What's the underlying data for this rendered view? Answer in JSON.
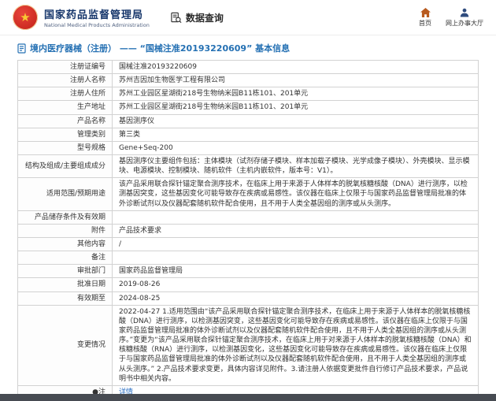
{
  "header": {
    "org_name": "国家药品监督管理局",
    "org_name_en": "National Medical Products Administration",
    "data_query": "数据查询",
    "home": "首页",
    "service_hall": "网上办事大厅"
  },
  "page": {
    "title": "境内医疗器械（注册） —— “国械注准20193220609” 基本信息"
  },
  "icons": {
    "logo-star": "★",
    "data-query": "clipboard-magnifier",
    "home": "house",
    "service-hall": "person",
    "page-title": "document"
  },
  "colors": {
    "accent_blue": "#2470b3",
    "org_navy": "#16366b",
    "logo_red": "#d6281e",
    "logo_gold": "#f8c933",
    "link_blue": "#2a6fc4",
    "border": "#d2d2d2",
    "footer": "#474b52"
  },
  "detail": {
    "rows": [
      {
        "label": "注册证编号",
        "value": "国械注准20193220609"
      },
      {
        "label": "注册人名称",
        "value": "苏州吉因加生物医学工程有限公司"
      },
      {
        "label": "注册人住所",
        "value": "苏州工业园区星湖街218号生物纳米园B11栋101、201单元"
      },
      {
        "label": "生产地址",
        "value": "苏州工业园区星湖街218号生物纳米园B11栋101、201单元"
      },
      {
        "label": "产品名称",
        "value": "基因测序仪"
      },
      {
        "label": "管理类别",
        "value": "第三类"
      },
      {
        "label": "型号规格",
        "value": "Gene+Seq-200"
      },
      {
        "label": "结构及组成/主要组成成分",
        "value": "基因测序仪主要组件包括：主体模块（试剂存储子模块、样本加载子模块、光学成像子模块）、外壳模块、显示模块、电源模块、控制模块、随机软件（主机内嵌软件，版本号：V1）。"
      },
      {
        "label": "适用范围/预期用途",
        "value": "该产品采用联合探针锚定聚合测序技术，在临床上用于来源于人体样本的脱氧核糖核酸（DNA）进行测序，以检测基因突变，这些基因变化可能导致存在疾病或易感性。该仪器在临床上仅限于与国家药品监督管理局批准的体外诊断试剂以及仪器配套随机软件配合使用，且不用于人类全基因组的测序或从头测序。"
      },
      {
        "label": "产品储存条件及有效期",
        "value": ""
      },
      {
        "label": "附件",
        "value": "产品技术要求"
      },
      {
        "label": "其他内容",
        "value": "/"
      },
      {
        "label": "备注",
        "value": ""
      },
      {
        "label": "审批部门",
        "value": "国家药品监督管理局"
      },
      {
        "label": "批准日期",
        "value": "2019-08-26"
      },
      {
        "label": "有效期至",
        "value": "2024-08-25"
      },
      {
        "label": "变更情况",
        "value": "2022-04-27 1.适用范围由“该产品采用联合探针锚定聚合测序技术，在临床上用于来源于人体样本的脱氧核糖核酸（DNA）进行测序，以检测基因突变，这些基因变化可能导致存在疾病或易感性。该仪器在临床上仅限于与国家药品监督管理局批准的体外诊断试剂以及仪器配套随机软件配合使用，且不用于人类全基因组的测序或从头测序。”变更为“该产品采用联合探针锚定聚合测序技术，在临床上用于对来源于人体样本的脱氧核糖核酸（DNA）和核糖核酸（RNA）进行测序，以检测基因变化，这些基因变化可能导致存在疾病或易感性。该仪器在临床上仅限于与国家药品监督管理局批准的体外诊断试剂以及仪器配套随机软件配合使用，且不用于人类全基因组的测序或从头测序。” 2.产品技术要求变更，具体内容详见附件。3.请注册人依据变更批件自行修订产品技术要求，产品说明书中相关内容。"
      },
      {
        "label": "●注",
        "value": "详情"
      }
    ]
  }
}
